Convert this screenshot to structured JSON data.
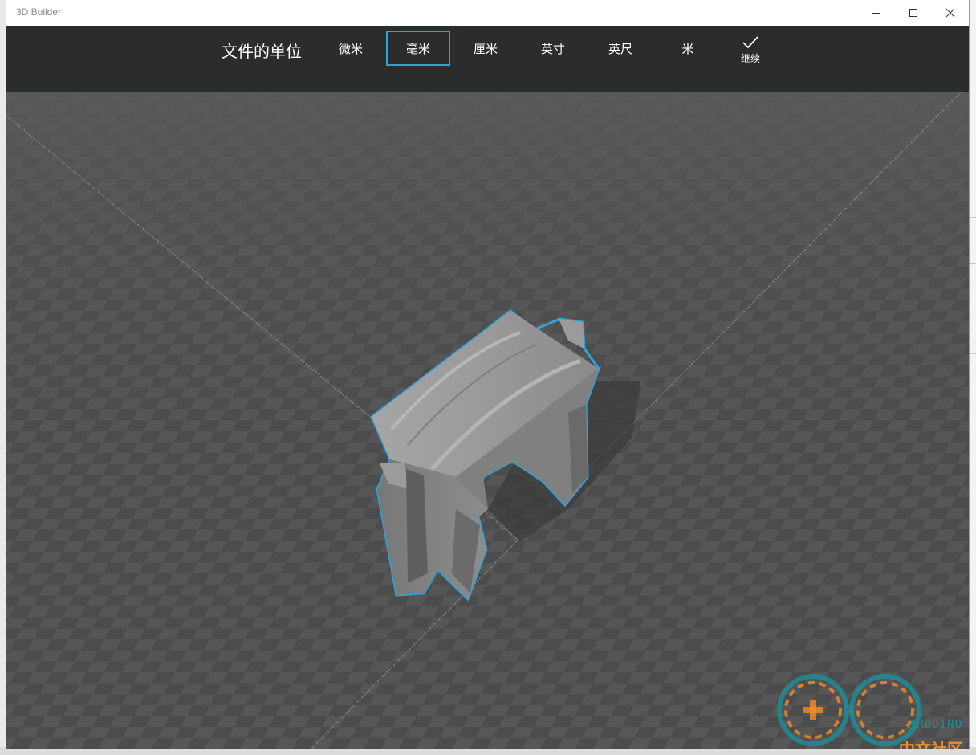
{
  "window": {
    "title": "3D Builder"
  },
  "unit_picker": {
    "label": "文件的单位",
    "options": [
      {
        "label": "微米",
        "selected": false
      },
      {
        "label": "毫米",
        "selected": true
      },
      {
        "label": "厘米",
        "selected": false
      },
      {
        "label": "英寸",
        "selected": false
      },
      {
        "label": "英尺",
        "selected": false
      },
      {
        "label": "米",
        "selected": false
      }
    ],
    "continue_label": "继续"
  },
  "watermark": {
    "brand": "ARDUINO",
    "sub": "中文社区"
  },
  "colors": {
    "accent": "#2ea3da",
    "toolbar_bg": "#2b2c2c",
    "model_gray": "#8f8f8f"
  },
  "icons": {
    "minimize": "minimize-icon",
    "maximize": "maximize-icon",
    "close": "close-icon",
    "continue": "checkmark-icon"
  }
}
